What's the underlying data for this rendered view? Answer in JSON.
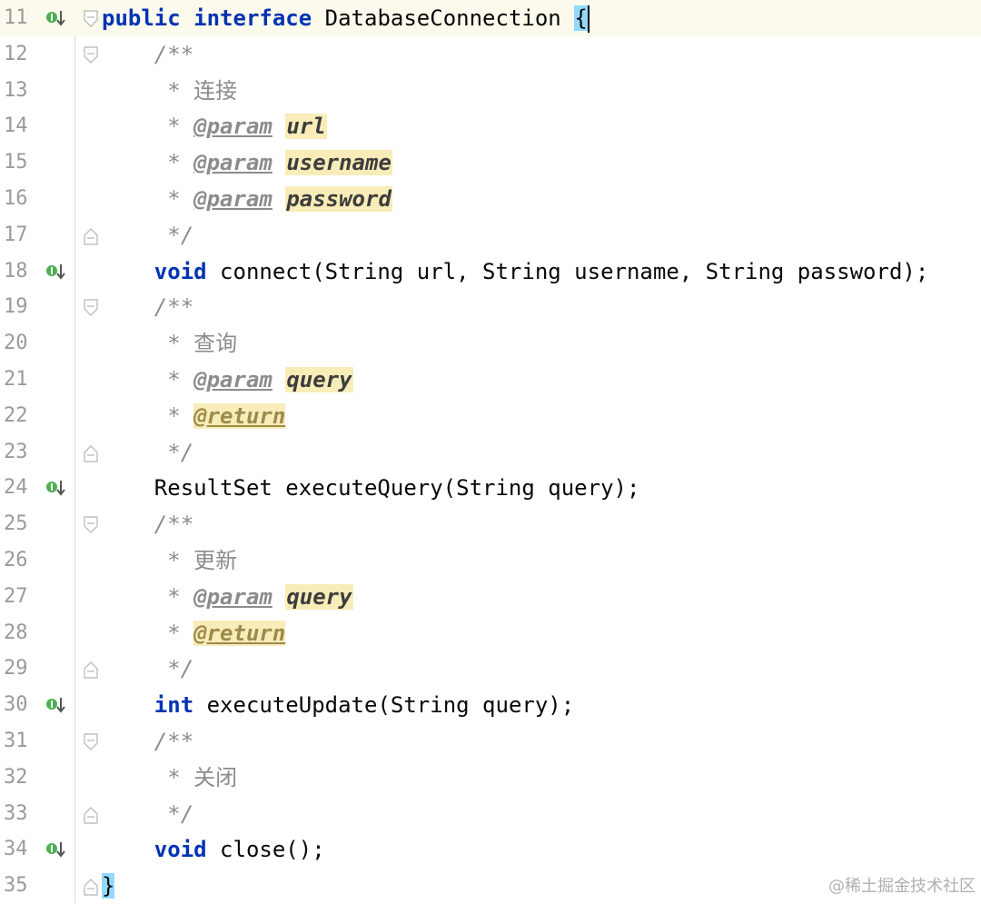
{
  "editor": {
    "current_line": 11,
    "lines": [
      {
        "n": "11",
        "gutter_icon": "implemented-icon",
        "fold": "fold-open-icon",
        "tokens": [
          {
            "t": "public",
            "c": "kw"
          },
          {
            "t": " ",
            "c": "plain"
          },
          {
            "t": "interface",
            "c": "kw"
          },
          {
            "t": " DatabaseConnection ",
            "c": "plain"
          },
          {
            "t": "{",
            "c": "brace-hl"
          }
        ],
        "caret": true
      },
      {
        "n": "12",
        "fold": "fold-open-icon",
        "indent": "    ",
        "tokens": [
          {
            "t": "/**",
            "c": "cm"
          }
        ]
      },
      {
        "n": "13",
        "indent": "     ",
        "tokens": [
          {
            "t": "* 连接",
            "c": "cmt"
          }
        ]
      },
      {
        "n": "14",
        "indent": "     ",
        "tokens": [
          {
            "t": "* ",
            "c": "cm"
          },
          {
            "t": "@param",
            "c": "tag"
          },
          {
            "t": " ",
            "c": "cm"
          },
          {
            "t": "url",
            "c": "pn"
          }
        ]
      },
      {
        "n": "15",
        "indent": "     ",
        "tokens": [
          {
            "t": "* ",
            "c": "cm"
          },
          {
            "t": "@param",
            "c": "tag"
          },
          {
            "t": " ",
            "c": "cm"
          },
          {
            "t": "username",
            "c": "pn"
          }
        ]
      },
      {
        "n": "16",
        "indent": "     ",
        "tokens": [
          {
            "t": "* ",
            "c": "cm"
          },
          {
            "t": "@param",
            "c": "tag"
          },
          {
            "t": " ",
            "c": "cm"
          },
          {
            "t": "password",
            "c": "pn"
          }
        ]
      },
      {
        "n": "17",
        "fold": "fold-close-icon",
        "indent": "     ",
        "tokens": [
          {
            "t": "*/",
            "c": "cm"
          }
        ]
      },
      {
        "n": "18",
        "gutter_icon": "implemented-icon",
        "indent": "    ",
        "tokens": [
          {
            "t": "void",
            "c": "kw"
          },
          {
            "t": " connect(String url, String username, String password);",
            "c": "plain"
          }
        ]
      },
      {
        "n": "19",
        "fold": "fold-open-icon",
        "indent": "    ",
        "tokens": [
          {
            "t": "/**",
            "c": "cm"
          }
        ]
      },
      {
        "n": "20",
        "indent": "     ",
        "tokens": [
          {
            "t": "* 查询",
            "c": "cmt"
          }
        ]
      },
      {
        "n": "21",
        "indent": "     ",
        "tokens": [
          {
            "t": "* ",
            "c": "cm"
          },
          {
            "t": "@param",
            "c": "tag"
          },
          {
            "t": " ",
            "c": "cm"
          },
          {
            "t": "query",
            "c": "pn"
          }
        ]
      },
      {
        "n": "22",
        "indent": "     ",
        "tokens": [
          {
            "t": "* ",
            "c": "cm"
          },
          {
            "t": "@return",
            "c": "tag hl"
          }
        ]
      },
      {
        "n": "23",
        "fold": "fold-close-icon",
        "indent": "     ",
        "tokens": [
          {
            "t": "*/",
            "c": "cm"
          }
        ]
      },
      {
        "n": "24",
        "gutter_icon": "implemented-icon",
        "indent": "    ",
        "tokens": [
          {
            "t": "ResultSet executeQuery(String query);",
            "c": "plain"
          }
        ]
      },
      {
        "n": "25",
        "fold": "fold-open-icon",
        "indent": "    ",
        "tokens": [
          {
            "t": "/**",
            "c": "cm"
          }
        ]
      },
      {
        "n": "26",
        "indent": "     ",
        "tokens": [
          {
            "t": "* 更新",
            "c": "cmt"
          }
        ]
      },
      {
        "n": "27",
        "indent": "     ",
        "tokens": [
          {
            "t": "* ",
            "c": "cm"
          },
          {
            "t": "@param",
            "c": "tag"
          },
          {
            "t": " ",
            "c": "cm"
          },
          {
            "t": "query",
            "c": "pn"
          }
        ]
      },
      {
        "n": "28",
        "indent": "     ",
        "tokens": [
          {
            "t": "* ",
            "c": "cm"
          },
          {
            "t": "@return",
            "c": "tag hl"
          }
        ]
      },
      {
        "n": "29",
        "fold": "fold-close-icon",
        "indent": "     ",
        "tokens": [
          {
            "t": "*/",
            "c": "cm"
          }
        ]
      },
      {
        "n": "30",
        "gutter_icon": "implemented-icon",
        "indent": "    ",
        "tokens": [
          {
            "t": "int",
            "c": "kw"
          },
          {
            "t": " executeUpdate(String query);",
            "c": "plain"
          }
        ]
      },
      {
        "n": "31",
        "fold": "fold-open-icon",
        "indent": "    ",
        "tokens": [
          {
            "t": "/**",
            "c": "cm"
          }
        ]
      },
      {
        "n": "32",
        "indent": "     ",
        "tokens": [
          {
            "t": "* 关闭",
            "c": "cmt"
          }
        ]
      },
      {
        "n": "33",
        "fold": "fold-close-icon",
        "indent": "     ",
        "tokens": [
          {
            "t": "*/",
            "c": "cm"
          }
        ]
      },
      {
        "n": "34",
        "gutter_icon": "implemented-icon",
        "indent": "    ",
        "tokens": [
          {
            "t": "void",
            "c": "kw"
          },
          {
            "t": " close();",
            "c": "plain"
          }
        ]
      },
      {
        "n": "35",
        "fold": "fold-close-icon",
        "tokens": [
          {
            "t": "}",
            "c": "brace-hl"
          }
        ]
      }
    ]
  },
  "watermark": "@稀土掘金技术社区",
  "colors": {
    "keyword": "#0033b3",
    "comment": "#8c8c8c",
    "param_highlight": "#f8ecb8",
    "brace_highlight": "#93d9ff",
    "current_line": "#fcfaed",
    "gutter_icon": "#4caf50"
  }
}
